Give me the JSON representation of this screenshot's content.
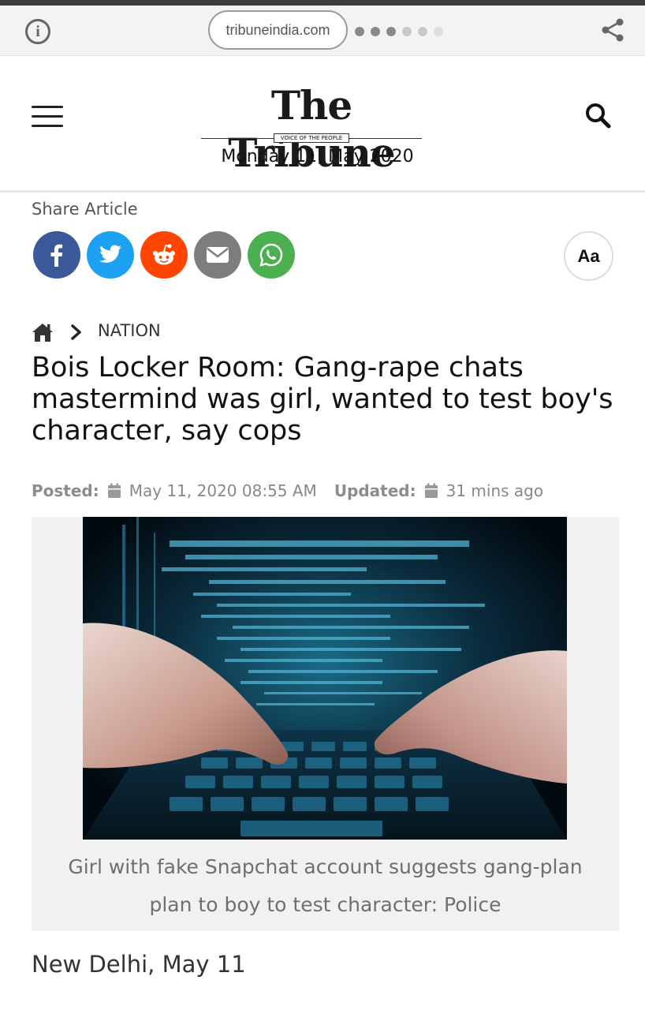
{
  "browser": {
    "url": "tribuneindia.com"
  },
  "header": {
    "logo_text": "The Tribune",
    "tagline": "VOICE OF THE PEOPLE",
    "date": "Monday 11, May 2020"
  },
  "share": {
    "label": "Share Article",
    "buttons": [
      "facebook",
      "twitter",
      "reddit",
      "email",
      "whatsapp"
    ],
    "font_size_label": "Aa"
  },
  "breadcrumb": {
    "section": "NATION"
  },
  "article": {
    "headline": "Bois Locker Room: Gang-rape chats mastermind was girl, wanted to test boy's character, say cops",
    "posted_label": "Posted:",
    "posted_value": "May 11, 2020 08:55 AM",
    "updated_label": "Updated:",
    "updated_value": "31 mins ago",
    "caption": "Girl with fake Snapchat account suggests gang-plan plan to boy to test character: Police",
    "dateline": "New Delhi, May 11"
  },
  "colors": {
    "facebook": "#3b5998",
    "twitter": "#1da1f2",
    "reddit": "#ff4500",
    "email": "#7d7d7d",
    "whatsapp": "#4caf50"
  }
}
